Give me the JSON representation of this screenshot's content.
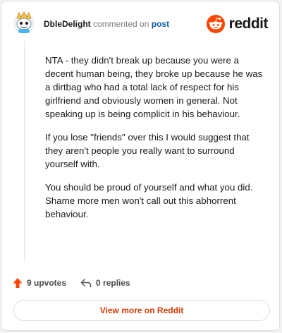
{
  "header": {
    "author": "DbleDelight",
    "verb": "commented on",
    "post_link": "post",
    "logo_text": "reddit"
  },
  "comment": {
    "paragraphs": [
      "NTA - they didn't break up because you were a decent human being, they broke up because he was a dirtbag who had a total lack of respect for his girlfriend and obviously women in general. Not speaking up is being complicit in his behaviour.",
      "If you lose \"friends\" over this I would suggest that they aren't people you really want to surround yourself with.",
      "You should be proud of yourself and what you did. Shame more men won't call out this abhorrent behaviour."
    ]
  },
  "actions": {
    "upvotes": "9 upvotes",
    "replies": "0 replies"
  },
  "footer": {
    "view_more": "View more on Reddit"
  },
  "colors": {
    "brand": "#ff4500",
    "link": "#0b5aa3",
    "view_more": "#d93a00"
  },
  "icons": {
    "avatar": "snoo-avatar",
    "logo": "reddit-snoo-icon",
    "upvote": "upvote-arrow-icon",
    "reply": "reply-arrow-icon"
  }
}
